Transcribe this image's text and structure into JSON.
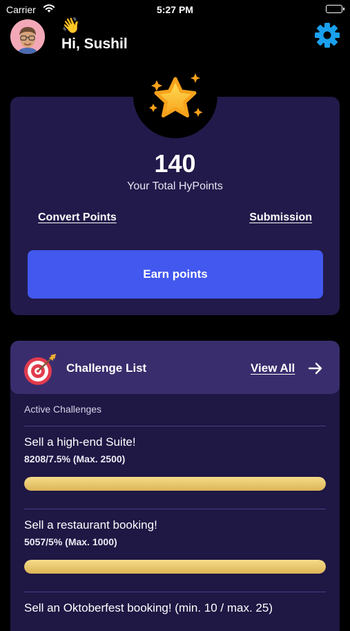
{
  "status_bar": {
    "carrier": "Carrier",
    "time": "5:27 PM"
  },
  "header": {
    "wave_emoji": "👋",
    "greeting": "Hi, Sushil",
    "avatar_icon": "memoji-avatar",
    "settings_icon": "gear-icon"
  },
  "points_card": {
    "badge_icon": "star-icon",
    "total_points": "140",
    "label": "Your Total HyPoints",
    "convert_link": "Convert Points",
    "submission_link": "Submission",
    "earn_button": "Earn points"
  },
  "challenges": {
    "title": "Challenge List",
    "view_all": "View All",
    "section_label": "Active Challenges",
    "items": [
      {
        "title": "Sell a high-end Suite!",
        "details": "8208/7.5% (Max. 2500)",
        "progress": 1.0
      },
      {
        "title": "Sell a restaurant booking!",
        "details": "5057/5% (Max. 1000)",
        "progress": 1.0
      },
      {
        "title": "Sell an Oktoberfest booking! (min. 10 / max. 25)"
      }
    ]
  },
  "colors": {
    "background": "#000000",
    "card": "#221a4a",
    "accent_button": "#4258ee",
    "progress_fill": "#e8c66e",
    "gear": "#1aa0ee"
  }
}
